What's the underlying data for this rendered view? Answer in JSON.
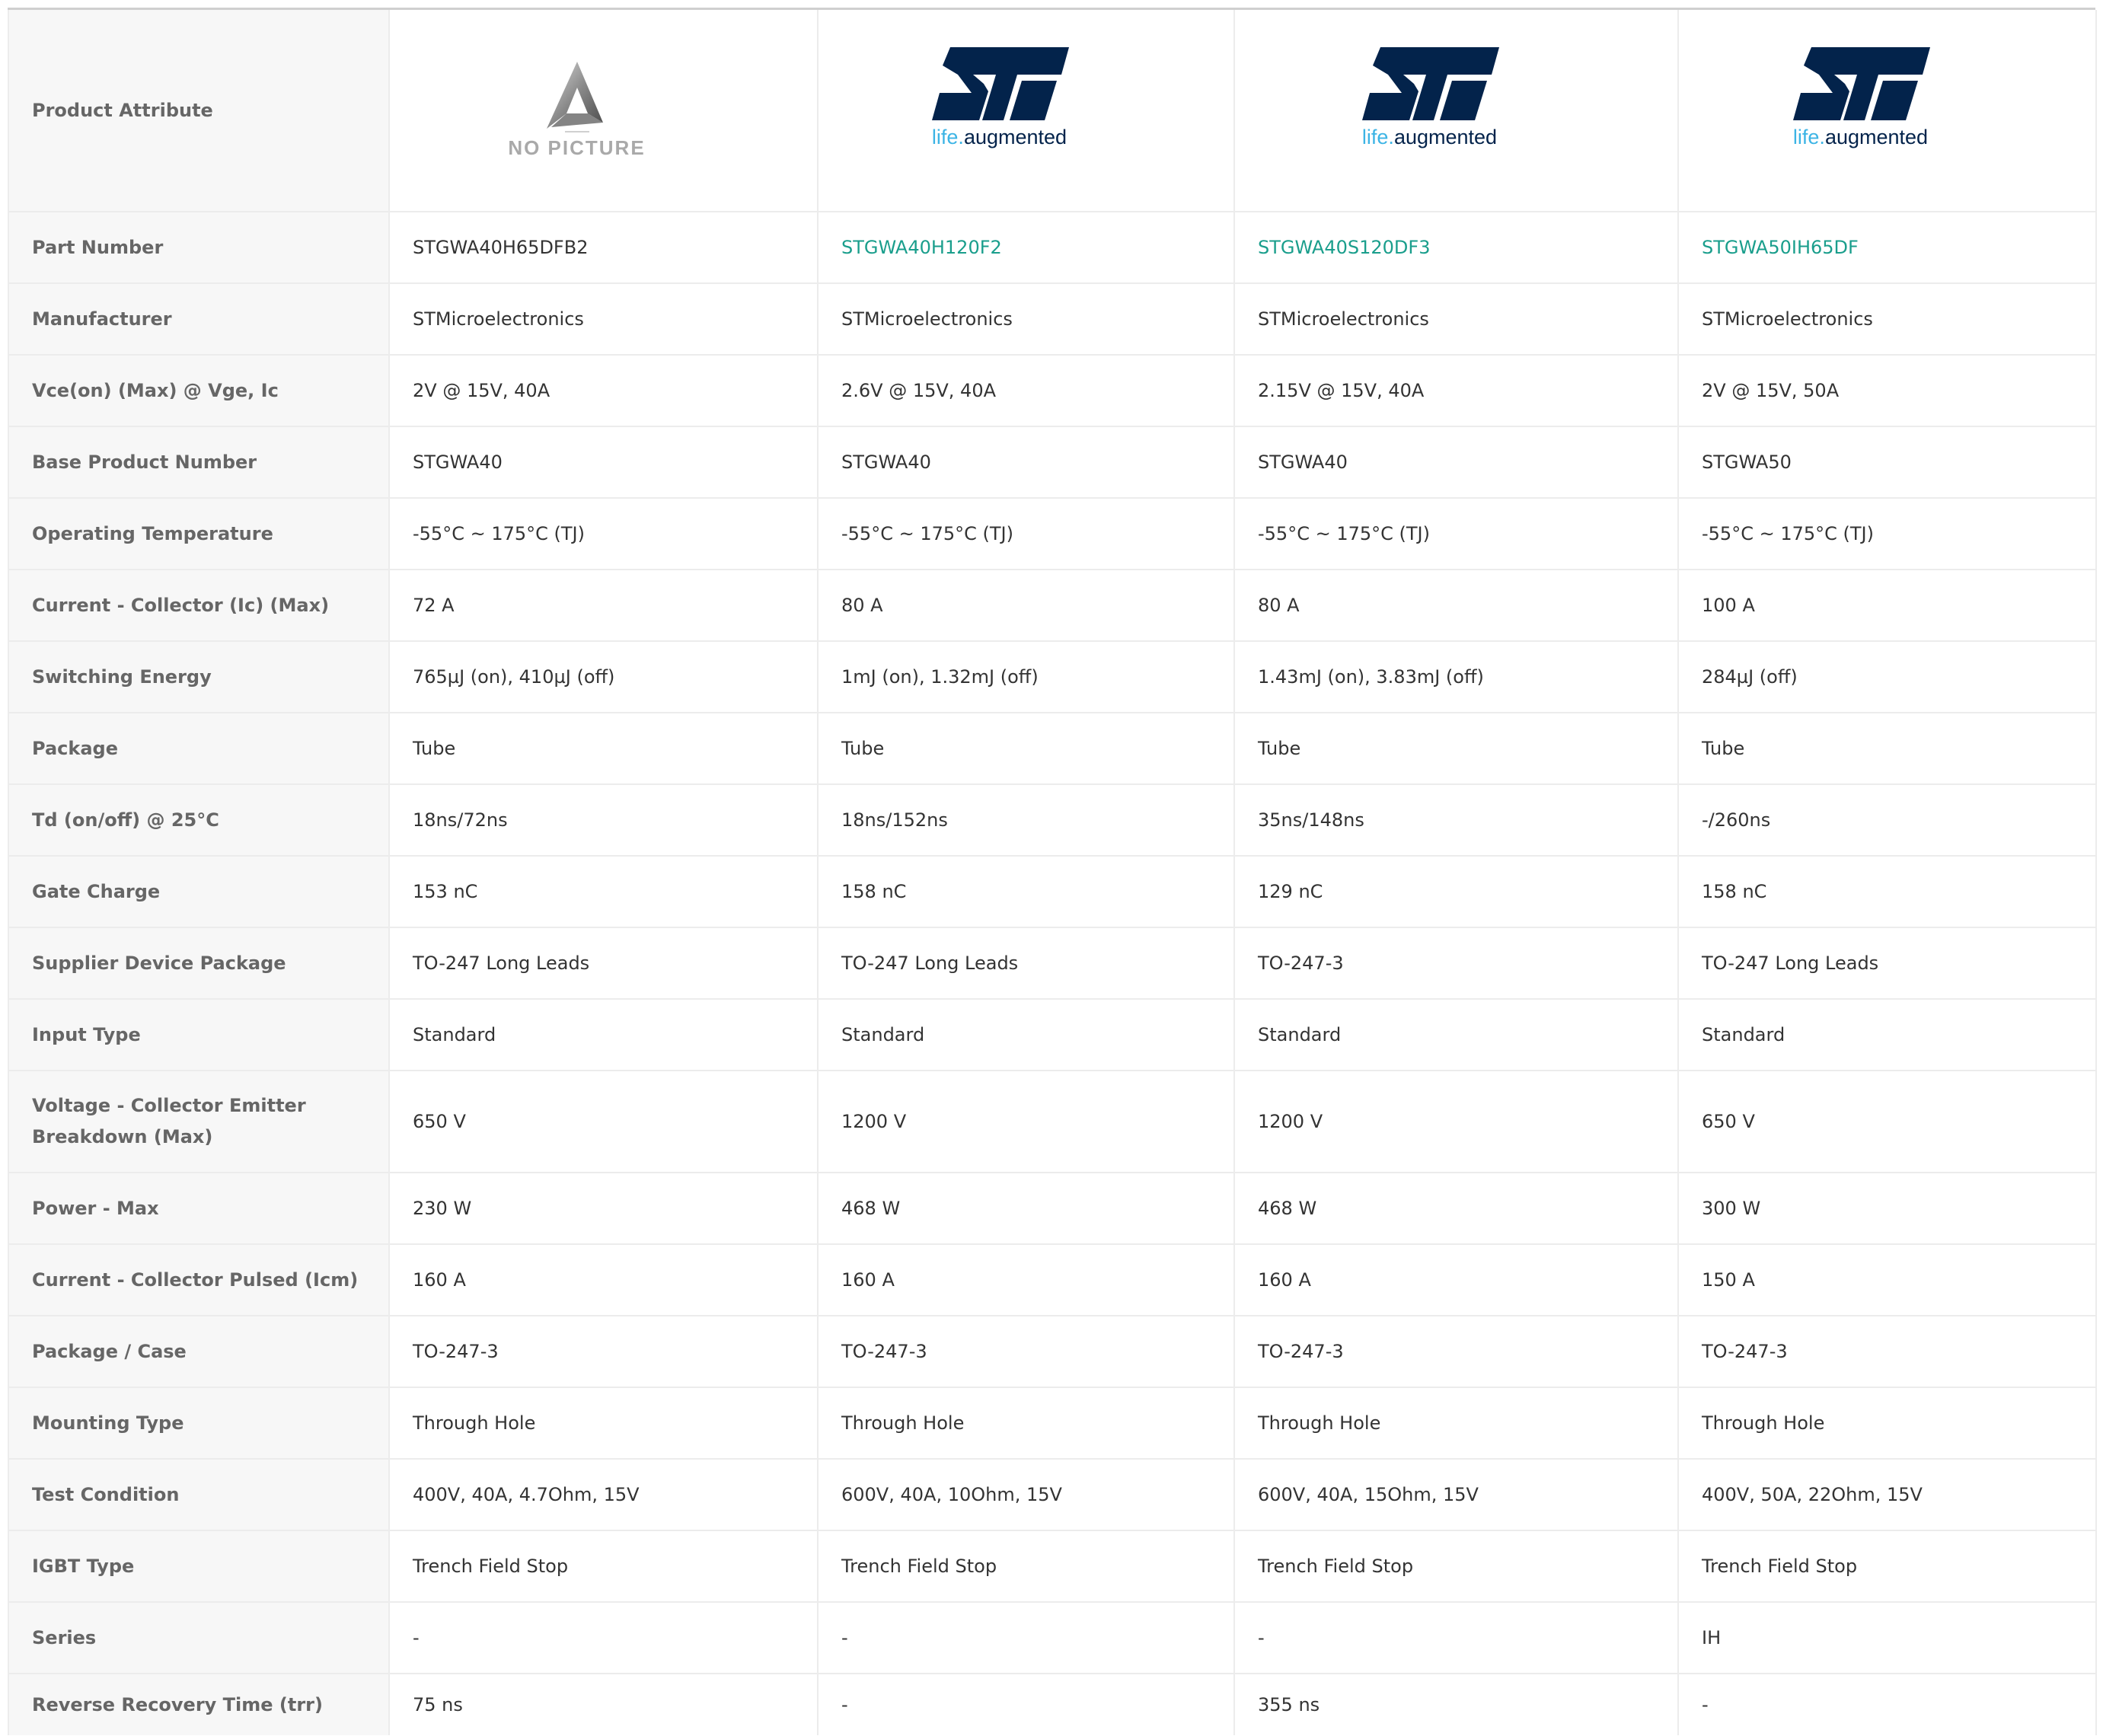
{
  "header": {
    "attribute_label": "Product Attribute",
    "no_picture_text": "NO PICTURE",
    "st_tagline_part1": "life.",
    "st_tagline_part2": "augmented",
    "st_colors": {
      "logo_blue": "#03234b",
      "tagline_light": "#3cb4e5",
      "tagline_dark": "#03234b"
    }
  },
  "colors": {
    "link": "#1a9e8c",
    "attr_text": "#666666",
    "value_text": "#333333"
  },
  "products": [
    {
      "logo": "no-picture",
      "part_number": "STGWA40H65DFB2",
      "part_is_link": false
    },
    {
      "logo": "st-logo",
      "part_number": "STGWA40H120F2",
      "part_is_link": true
    },
    {
      "logo": "st-logo",
      "part_number": "STGWA40S120DF3",
      "part_is_link": true
    },
    {
      "logo": "st-logo",
      "part_number": "STGWA50IH65DF",
      "part_is_link": true
    }
  ],
  "rows": [
    {
      "label": "Manufacturer",
      "values": [
        "STMicroelectronics",
        "STMicroelectronics",
        "STMicroelectronics",
        "STMicroelectronics"
      ]
    },
    {
      "label": "Vce(on) (Max) @ Vge, Ic",
      "values": [
        "2V @ 15V, 40A",
        "2.6V @ 15V, 40A",
        "2.15V @ 15V, 40A",
        "2V @ 15V, 50A"
      ]
    },
    {
      "label": "Base Product Number",
      "values": [
        "STGWA40",
        "STGWA40",
        "STGWA40",
        "STGWA50"
      ]
    },
    {
      "label": "Operating Temperature",
      "values": [
        "-55°C ~ 175°C (TJ)",
        "-55°C ~ 175°C (TJ)",
        "-55°C ~ 175°C (TJ)",
        "-55°C ~ 175°C (TJ)"
      ]
    },
    {
      "label": "Current - Collector (Ic) (Max)",
      "values": [
        "72 A",
        "80 A",
        "80 A",
        "100 A"
      ]
    },
    {
      "label": "Switching Energy",
      "values": [
        "765µJ (on), 410µJ (off)",
        "1mJ (on), 1.32mJ (off)",
        "1.43mJ (on), 3.83mJ (off)",
        "284µJ (off)"
      ]
    },
    {
      "label": "Package",
      "values": [
        "Tube",
        "Tube",
        "Tube",
        "Tube"
      ]
    },
    {
      "label": "Td (on/off) @ 25°C",
      "values": [
        "18ns/72ns",
        "18ns/152ns",
        "35ns/148ns",
        "-/260ns"
      ]
    },
    {
      "label": "Gate Charge",
      "values": [
        "153 nC",
        "158 nC",
        "129 nC",
        "158 nC"
      ]
    },
    {
      "label": "Supplier Device Package",
      "values": [
        "TO-247 Long Leads",
        "TO-247 Long Leads",
        "TO-247-3",
        "TO-247 Long Leads"
      ]
    },
    {
      "label": "Input Type",
      "values": [
        "Standard",
        "Standard",
        "Standard",
        "Standard"
      ]
    },
    {
      "label": "Voltage - Collector Emitter Breakdown (Max)",
      "values": [
        "650 V",
        "1200 V",
        "1200 V",
        "650 V"
      ]
    },
    {
      "label": "Power - Max",
      "values": [
        "230 W",
        "468 W",
        "468 W",
        "300 W"
      ]
    },
    {
      "label": "Current - Collector Pulsed (Icm)",
      "values": [
        "160 A",
        "160 A",
        "160 A",
        "150 A"
      ]
    },
    {
      "label": "Package / Case",
      "values": [
        "TO-247-3",
        "TO-247-3",
        "TO-247-3",
        "TO-247-3"
      ]
    },
    {
      "label": "Mounting Type",
      "values": [
        "Through Hole",
        "Through Hole",
        "Through Hole",
        "Through Hole"
      ]
    },
    {
      "label": "Test Condition",
      "values": [
        "400V, 40A, 4.7Ohm, 15V",
        "600V, 40A, 10Ohm, 15V",
        "600V, 40A, 15Ohm, 15V",
        "400V, 50A, 22Ohm, 15V"
      ]
    },
    {
      "label": "IGBT Type",
      "values": [
        "Trench Field Stop",
        "Trench Field Stop",
        "Trench Field Stop",
        "Trench Field Stop"
      ]
    },
    {
      "label": "Series",
      "values": [
        "-",
        "-",
        "-",
        "IH"
      ]
    },
    {
      "label": "Reverse Recovery Time (trr)",
      "values": [
        "75 ns",
        "-",
        "355 ns",
        "-"
      ]
    }
  ]
}
